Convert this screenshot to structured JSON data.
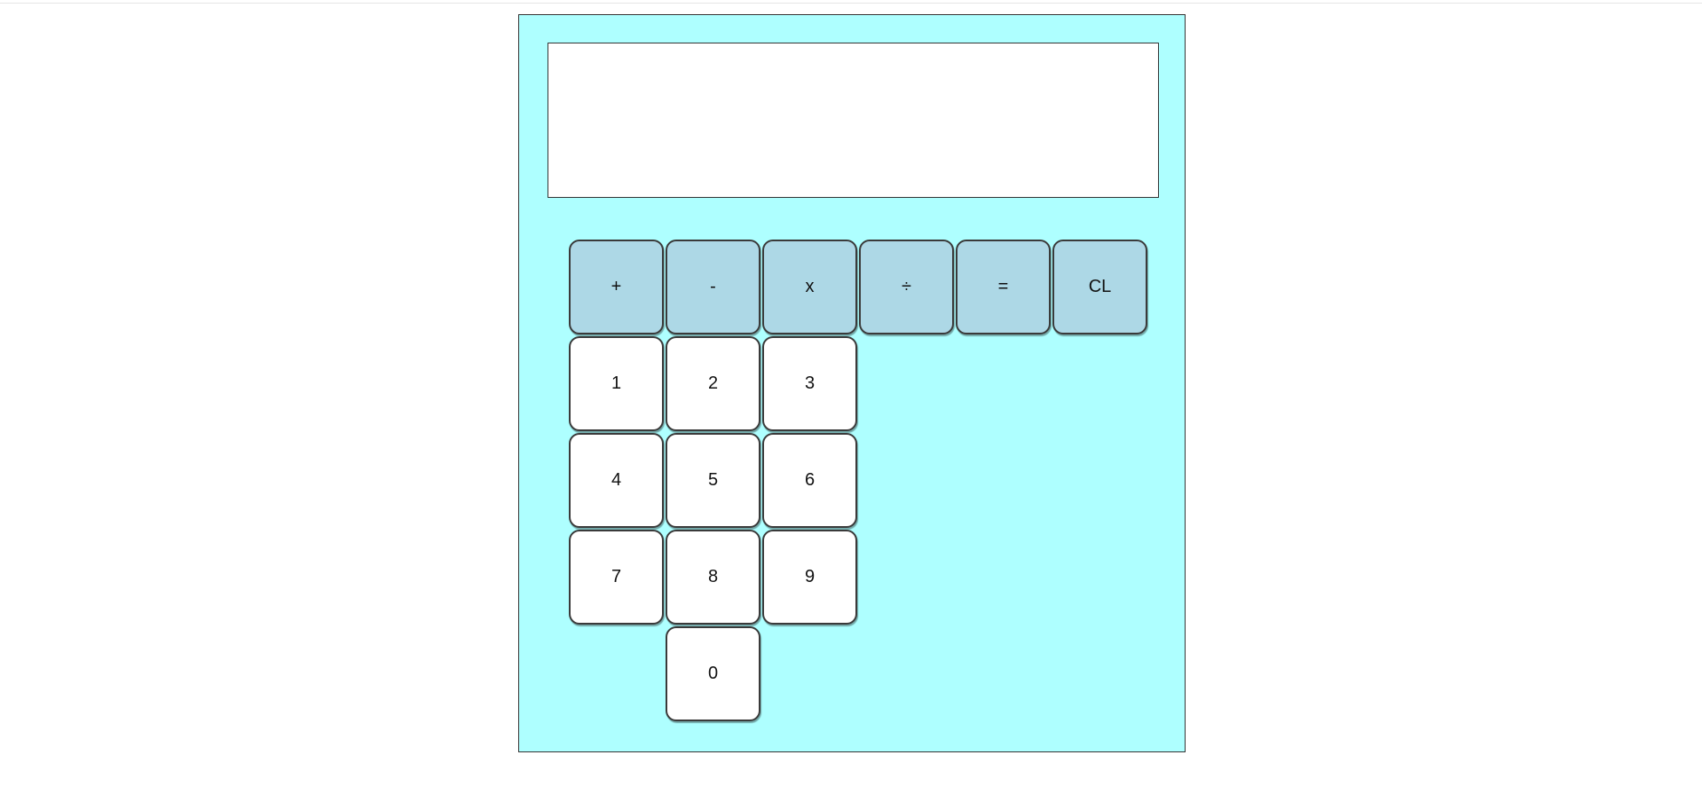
{
  "display": {
    "value": ""
  },
  "operators": [
    "+",
    "-",
    "x",
    "÷",
    "=",
    "CL"
  ],
  "digits": {
    "row1": [
      "1",
      "2",
      "3"
    ],
    "row2": [
      "4",
      "5",
      "6"
    ],
    "row3": [
      "7",
      "8",
      "9"
    ],
    "zero": "0"
  },
  "colors": {
    "calculator_bg": "#aeffff",
    "operator_key_bg": "#add8e6",
    "digit_key_bg": "#ffffff"
  }
}
